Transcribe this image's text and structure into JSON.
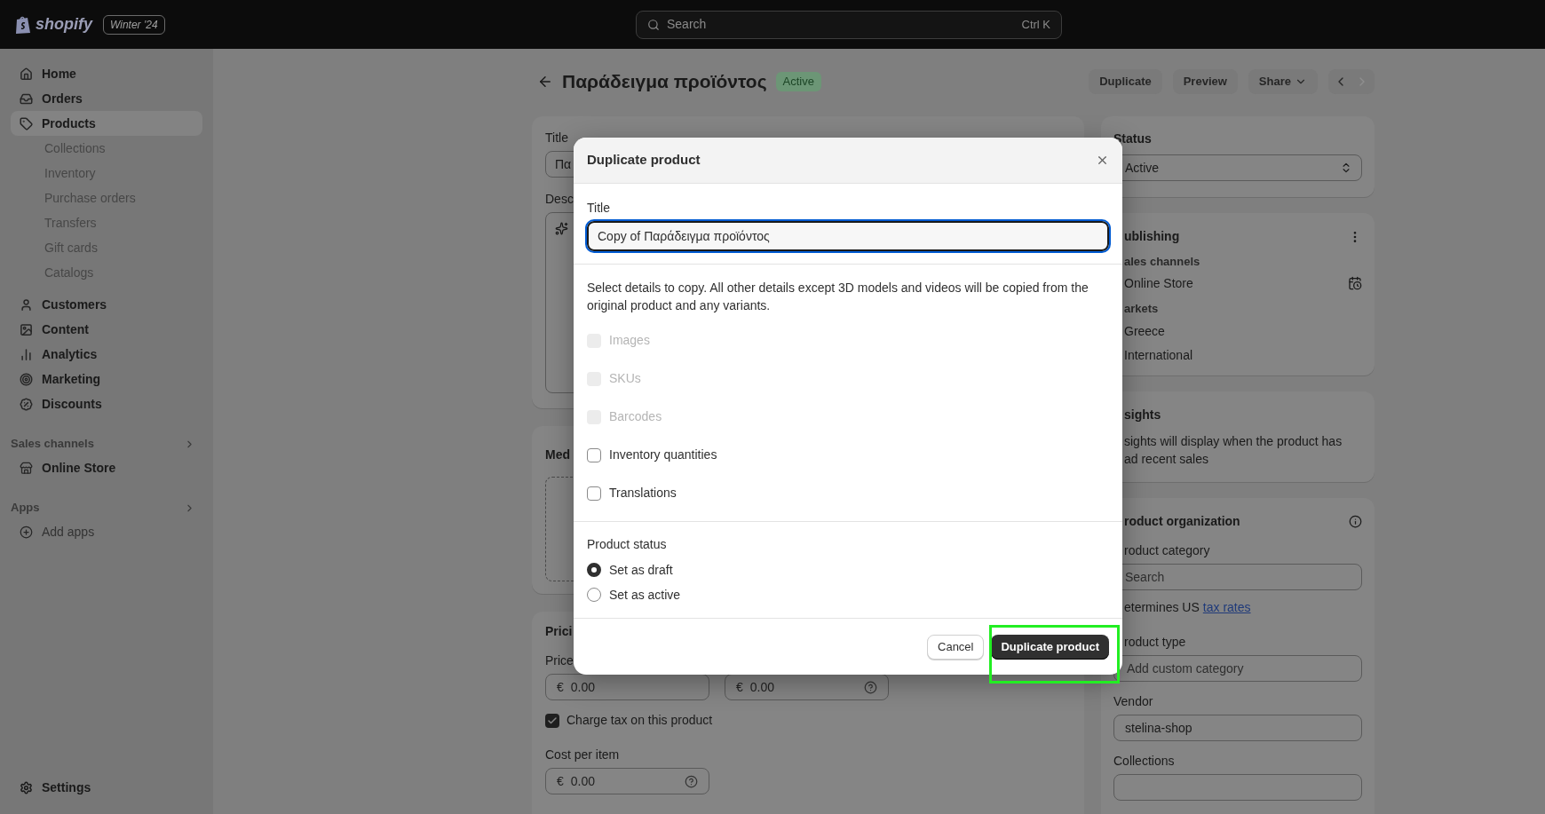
{
  "topbar": {
    "logo": "shopify",
    "edition": "Winter '24",
    "search": {
      "placeholder": "Search",
      "shortcut": "Ctrl K"
    }
  },
  "sidebar": {
    "items": [
      {
        "label": "Home",
        "selected": false
      },
      {
        "label": "Orders",
        "selected": false
      },
      {
        "label": "Products",
        "selected": true,
        "children": [
          {
            "label": "Collections"
          },
          {
            "label": "Inventory"
          },
          {
            "label": "Purchase orders"
          },
          {
            "label": "Transfers"
          },
          {
            "label": "Gift cards"
          },
          {
            "label": "Catalogs"
          }
        ]
      },
      {
        "label": "Customers",
        "selected": false
      },
      {
        "label": "Content",
        "selected": false
      },
      {
        "label": "Analytics",
        "selected": false
      },
      {
        "label": "Marketing",
        "selected": false
      },
      {
        "label": "Discounts",
        "selected": false
      }
    ],
    "sections": [
      {
        "title": "Sales channels",
        "items": [
          {
            "label": "Online Store"
          }
        ]
      },
      {
        "title": "Apps",
        "items": [
          {
            "label": "Add apps"
          }
        ]
      }
    ],
    "footer": {
      "label": "Settings"
    }
  },
  "page": {
    "title": "Παράδειγμα προϊόντος",
    "badge": "Active",
    "actions": [
      "Duplicate",
      "Preview",
      "Share"
    ],
    "pager": {
      "previous_disabled": false,
      "next_disabled": true
    }
  },
  "product_card": {
    "title_label": "Title",
    "title_value": "Πα",
    "description_label": "Desc"
  },
  "media_card": {
    "heading": "Med"
  },
  "pricing_card": {
    "heading": "Prici",
    "price_label": "Price",
    "price": {
      "prefix": "€",
      "value": "0.00"
    },
    "compare": {
      "prefix": "€",
      "value": "0.00"
    },
    "charge_tax": {
      "label": "Charge tax on this product",
      "checked": true
    },
    "cost_label": "Cost per item",
    "cost": {
      "prefix": "€",
      "value": "0.00"
    }
  },
  "status_card": {
    "heading": "Status",
    "value": "Active"
  },
  "publishing_card": {
    "heading": "ublishing",
    "channels_label": "ales channels",
    "channels": [
      "Online Store"
    ],
    "markets_label": "arkets",
    "markets": [
      "Greece",
      "International"
    ]
  },
  "insights_card": {
    "heading": "sights",
    "lines": [
      "sights will display when the product has",
      "ad recent sales"
    ]
  },
  "organization_card": {
    "heading": "roduct organization",
    "category_label": "roduct category",
    "category_placeholder": "Search",
    "hint": "etermines US",
    "hint_link": "tax rates",
    "type_label": "roduct type",
    "type_placeholder": "Add custom category",
    "vendor_label": "Vendor",
    "vendor_value": "stelina-shop",
    "collections_label": "Collections"
  },
  "modal": {
    "title": "Duplicate product",
    "title_label": "Title",
    "title_value": "Copy of Παράδειγμα προϊόντος",
    "description": "Select details to copy. All other details except 3D models and videos will be copied from the original product and any variants.",
    "options": [
      {
        "label": "Images",
        "checked": false,
        "disabled": true
      },
      {
        "label": "SKUs",
        "checked": false,
        "disabled": true
      },
      {
        "label": "Barcodes",
        "checked": false,
        "disabled": true
      },
      {
        "label": "Inventory quantities",
        "checked": false,
        "disabled": false
      },
      {
        "label": "Translations",
        "checked": false,
        "disabled": false
      }
    ],
    "status_label": "Product status",
    "statuses": [
      {
        "label": "Set as draft",
        "selected": true
      },
      {
        "label": "Set as active",
        "selected": false
      }
    ],
    "buttons": [
      {
        "label": "Cancel",
        "kind": "secondary"
      },
      {
        "label": "Duplicate product",
        "kind": "primary",
        "highlighted": true
      }
    ]
  }
}
